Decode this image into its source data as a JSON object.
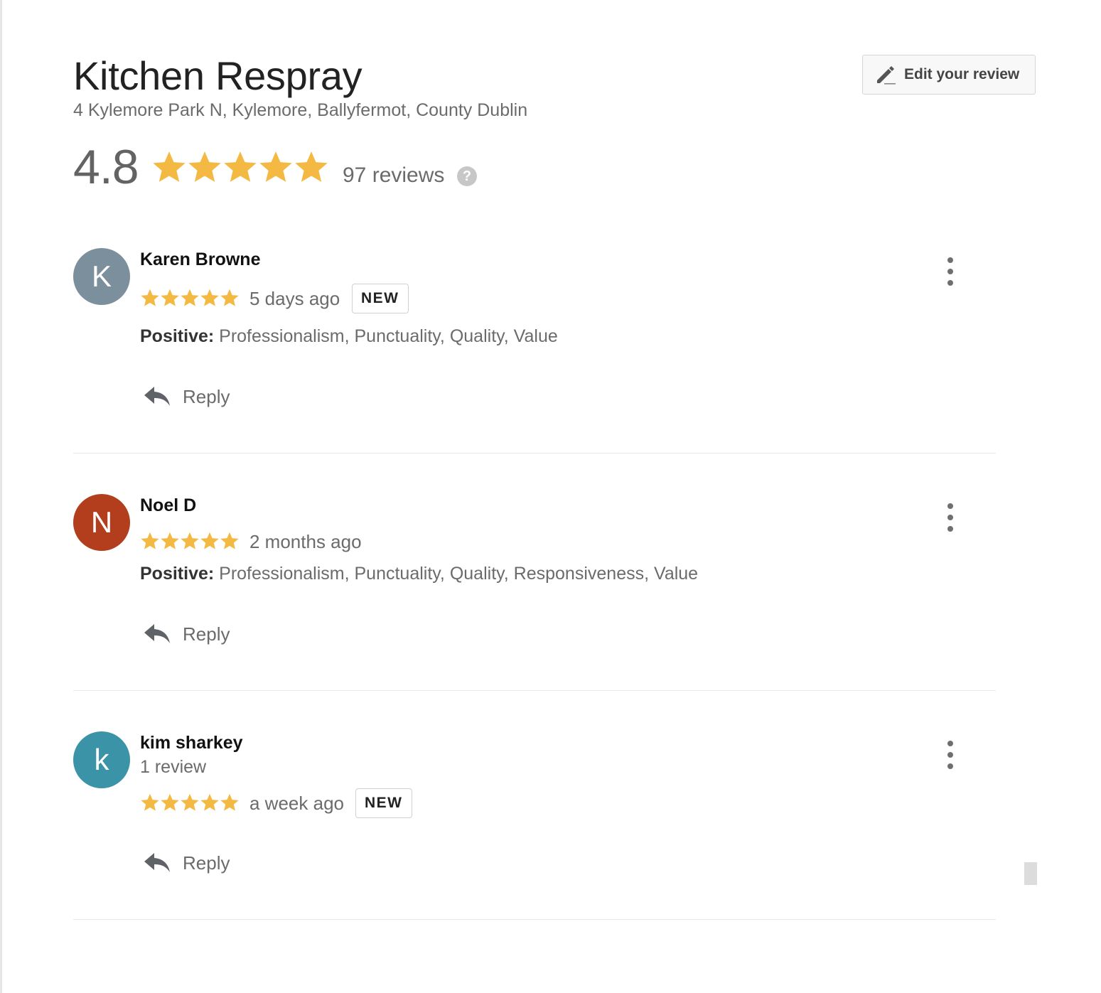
{
  "business": {
    "name": "Kitchen Respray",
    "address": "4 Kylemore Park N, Kylemore, Ballyfermot, County Dublin",
    "rating": "4.8",
    "rating_stars": 5,
    "reviews_count": "97 reviews",
    "help_label": "?"
  },
  "edit_button": {
    "label": "Edit your review",
    "icon": "pencil-icon"
  },
  "colors": {
    "star": "#F4B942",
    "text_muted": "#6b6b6b"
  },
  "reviews": [
    {
      "initial": "K",
      "avatar_color": "#7b8f9c",
      "name": "Karen Browne",
      "subtext": "",
      "stars": 5,
      "time": "5 days ago",
      "badge": "NEW",
      "attr_label": "Positive:",
      "attr_values": "Professionalism, Punctuality, Quality, Value",
      "reply_label": "Reply"
    },
    {
      "initial": "N",
      "avatar_color": "#b23e1d",
      "name": "Noel D",
      "subtext": "",
      "stars": 5,
      "time": "2 months ago",
      "badge": "",
      "attr_label": "Positive:",
      "attr_values": "Professionalism, Punctuality, Quality, Responsiveness, Value",
      "reply_label": "Reply"
    },
    {
      "initial": "k",
      "avatar_color": "#3a93a6",
      "name": "kim sharkey",
      "subtext": "1 review",
      "stars": 5,
      "time": "a week ago",
      "badge": "NEW",
      "attr_label": "",
      "attr_values": "",
      "reply_label": "Reply"
    }
  ]
}
